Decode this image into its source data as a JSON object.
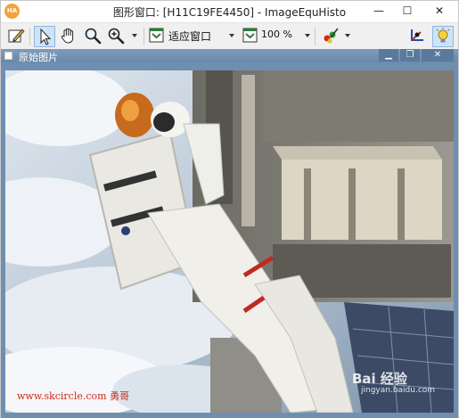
{
  "window": {
    "title": "图形窗口: [H11C19FE4450] - ImageEquHisto",
    "app_icon_text": "HA",
    "minimize_glyph": "—",
    "maximize_glyph": "☐",
    "close_glyph": "✕"
  },
  "toolbar": {
    "tools": [
      {
        "icon": "pen-tool-icon"
      },
      {
        "icon": "pointer-arrow-icon",
        "selected": true
      },
      {
        "icon": "hand-pan-icon"
      },
      {
        "icon": "magnifier-icon"
      },
      {
        "icon": "zoom-in-icon"
      }
    ],
    "fit_mode": "适应窗口",
    "zoom_value": "100 %",
    "accent": "#cfe3f7"
  },
  "child_window": {
    "title": "原始图片",
    "minimize_glyph": "▁",
    "restore_glyph": "❐",
    "close_glyph": "✕"
  },
  "watermarks": {
    "site": "www.skcircle.com 勇哥",
    "baidu_logo": "Bai 经验",
    "baidu_url": "jingyan.baidu.com"
  }
}
